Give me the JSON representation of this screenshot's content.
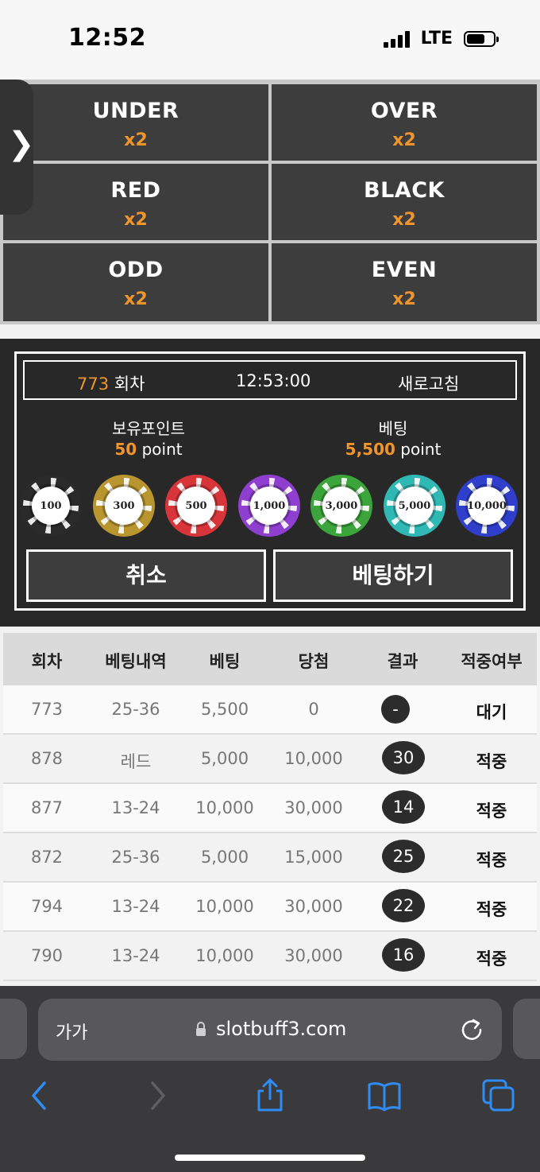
{
  "status_bar": {
    "time": "12:52",
    "network": "LTE"
  },
  "side_tab": {
    "glyph": "❯"
  },
  "bet_options": [
    {
      "name": "UNDER",
      "multiplier": "x2"
    },
    {
      "name": "OVER",
      "multiplier": "x2"
    },
    {
      "name": "RED",
      "multiplier": "x2"
    },
    {
      "name": "BLACK",
      "multiplier": "x2"
    },
    {
      "name": "ODD",
      "multiplier": "x2"
    },
    {
      "name": "EVEN",
      "multiplier": "x2"
    }
  ],
  "panel": {
    "round_number": "773",
    "round_suffix": " 회차",
    "clock": "12:53:00",
    "refresh_label": "새로고침",
    "points_label": "보유포인트",
    "points_value": "50",
    "betting_label": "베팅",
    "betting_value": "5,500",
    "point_unit": " point",
    "chips": [
      {
        "label": "100",
        "color": "#2a2a2a"
      },
      {
        "label": "300",
        "color": "#b8952f"
      },
      {
        "label": "500",
        "color": "#d8353a"
      },
      {
        "label": "1,000",
        "color": "#8e3fd0"
      },
      {
        "label": "3,000",
        "color": "#3ba43a"
      },
      {
        "label": "5,000",
        "color": "#2fb8b4"
      },
      {
        "label": "10,000",
        "color": "#2f3fcc"
      }
    ],
    "cancel_label": "취소",
    "bet_label": "베팅하기"
  },
  "history": {
    "headers": [
      "회차",
      "베팅내역",
      "베팅",
      "당첨",
      "결과",
      "적중여부"
    ],
    "rows": [
      {
        "round": "773",
        "pick": "25-36",
        "bet": "5,500",
        "win": "0",
        "result": "-",
        "status": "대기"
      },
      {
        "round": "878",
        "pick": "레드",
        "bet": "5,000",
        "win": "10,000",
        "result": "30",
        "status": "적중"
      },
      {
        "round": "877",
        "pick": "13-24",
        "bet": "10,000",
        "win": "30,000",
        "result": "14",
        "status": "적중"
      },
      {
        "round": "872",
        "pick": "25-36",
        "bet": "5,000",
        "win": "15,000",
        "result": "25",
        "status": "적중"
      },
      {
        "round": "794",
        "pick": "13-24",
        "bet": "10,000",
        "win": "30,000",
        "result": "22",
        "status": "적중"
      },
      {
        "round": "790",
        "pick": "13-24",
        "bet": "10,000",
        "win": "30,000",
        "result": "16",
        "status": "적중"
      }
    ]
  },
  "browser": {
    "text_size_label": "가가",
    "url": "slotbuff3.com",
    "toolbar_icons": [
      "back-icon",
      "forward-icon",
      "share-icon",
      "bookmarks-icon",
      "tabs-icon"
    ],
    "accent_color": "#2f8cf5"
  }
}
